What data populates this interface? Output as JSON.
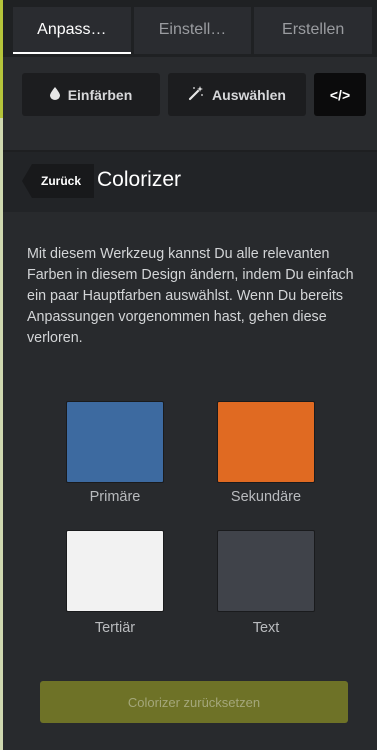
{
  "tabs": [
    {
      "label": "Anpass…",
      "active": true
    },
    {
      "label": "Einstell…",
      "active": false
    },
    {
      "label": "Erstellen",
      "active": false
    }
  ],
  "tools": {
    "colorize": {
      "label": "Einfärben",
      "icon": "drop-icon"
    },
    "select": {
      "label": "Auswählen",
      "icon": "magic-wand-icon"
    },
    "code": {
      "label": "</>",
      "icon": "code-icon"
    }
  },
  "header": {
    "back_label": "Zurück",
    "title": "Colorizer"
  },
  "description": "Mit diesem Werkzeug kannst Du alle relevanten Farben in diesem Design ändern, indem Du einfach ein paar Hauptfarben auswählst. Wenn Du bereits Anpassungen vorgenommen hast, gehen diese verloren.",
  "swatches": [
    {
      "label": "Primäre",
      "color": "#3d6aa0"
    },
    {
      "label": "Sekundäre",
      "color": "#e06a22"
    },
    {
      "label": "Tertiär",
      "color": "#f2f2f2"
    },
    {
      "label": "Text",
      "color": "#40434a"
    }
  ],
  "reset_label": "Colorizer zurücksetzen",
  "colors": {
    "accent": "#b5c43a",
    "reset_button": "#6e7227"
  }
}
